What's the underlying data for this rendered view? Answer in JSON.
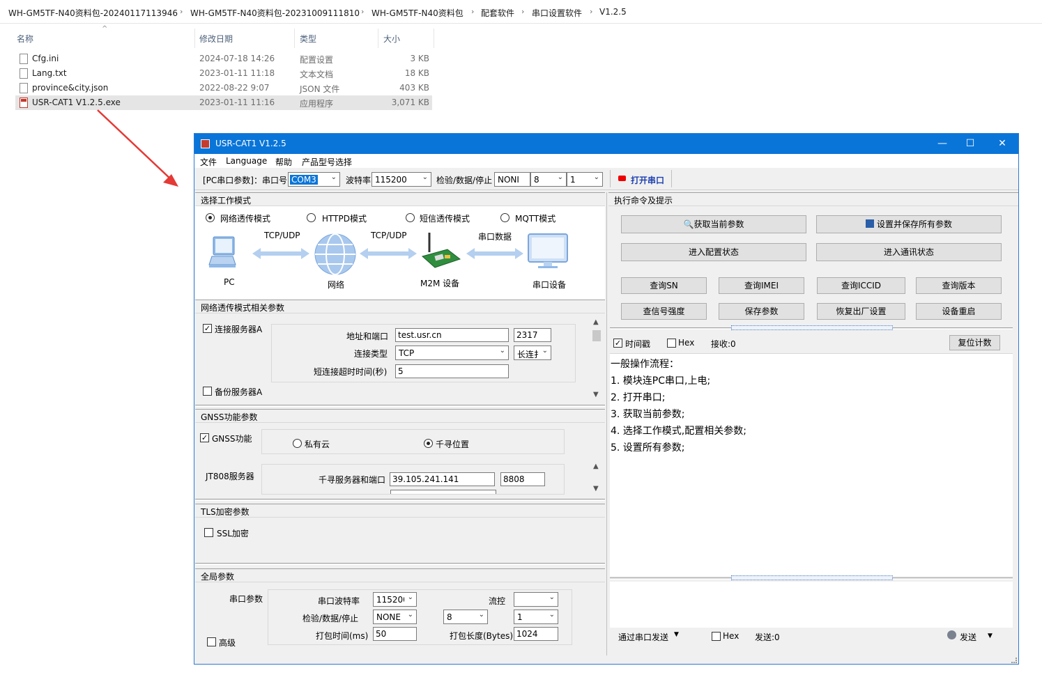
{
  "breadcrumb": [
    "WH-GM5TF-N40资料包-20240117113946",
    "WH-GM5TF-N40资料包-20231009111810",
    "WH-GM5TF-N40资料包",
    "配套软件",
    "串口设置软件",
    "V1.2.5"
  ],
  "breadcrumb_sep": "›",
  "explorer": {
    "columns": {
      "name": "名称",
      "date": "修改日期",
      "type": "类型",
      "size": "大小"
    },
    "sort_arrow": "^",
    "files": [
      {
        "name": "Cfg.ini",
        "date": "2024-07-18 14:26",
        "type": "配置设置",
        "size": "3 KB"
      },
      {
        "name": "Lang.txt",
        "date": "2023-01-11 11:18",
        "type": "文本文档",
        "size": "18 KB"
      },
      {
        "name": "province&city.json",
        "date": "2022-08-22 9:07",
        "type": "JSON 文件",
        "size": "403 KB"
      },
      {
        "name": "USR-CAT1 V1.2.5.exe",
        "date": "2023-01-11 11:16",
        "type": "应用程序",
        "size": "3,071 KB"
      }
    ]
  },
  "window": {
    "title": "USR-CAT1 V1.2.5",
    "minimize": "—",
    "maximize": "☐",
    "close": "✕",
    "menu": [
      "文件",
      "Language",
      "帮助",
      "产品型号选择"
    ],
    "toolbar": {
      "pc_serial_label": "[PC串口参数]：串口号",
      "port": "COM3",
      "baud_label": "波特率",
      "baud": "115200",
      "check_label": "检验/数据/停止",
      "parity": "NONI",
      "databits": "8",
      "stopbits": "1",
      "open_port": "打开串口"
    },
    "mode": {
      "header": "选择工作模式",
      "options": [
        "网络透传模式",
        "HTTPD模式",
        "短信透传模式",
        "MQTT模式"
      ],
      "selected": 0,
      "diagram": {
        "pc": "PC",
        "network": "网络",
        "m2m": "M2M 设备",
        "serial_device": "串口设备",
        "link1": "TCP/UDP",
        "link2": "TCP/UDP",
        "link3": "串口数据"
      }
    },
    "net_params": {
      "header": "网络透传模式相关参数",
      "server_a": "连接服务器A",
      "server_a_checked": true,
      "addr_label": "地址和端口",
      "addr": "test.usr.cn",
      "port": "2317",
      "conn_type_label": "连接类型",
      "conn_type": "TCP",
      "conn_mode": "长连扌",
      "timeout_label": "短连接超时时间(秒)",
      "timeout": "5",
      "backup_server": "备份服务器A",
      "backup_checked": false
    },
    "gnss": {
      "header": "GNSS功能参数",
      "enable": "GNSS功能",
      "enabled": true,
      "private_cloud": "私有云",
      "qianxun": "千寻位置",
      "selected": "qianxun",
      "jt808": "JT808服务器",
      "server_label": "千寻服务器和端口",
      "server": "39.105.241.141",
      "port": "8808"
    },
    "tls": {
      "header": "TLS加密参数",
      "ssl": "SSL加密",
      "ssl_checked": false
    },
    "global": {
      "header": "全局参数",
      "serial_params": "串口参数",
      "baud_label": "串口波特率",
      "baud": "115200",
      "flow_label": "流控",
      "flow": "",
      "check_label": "检验/数据/停止",
      "parity": "NONE",
      "databits": "8",
      "stopbits": "1",
      "pack_time_label": "打包时间(ms)",
      "pack_time": "50",
      "pack_len_label": "打包长度(Bytes)",
      "pack_len": "1024",
      "advanced": "高级",
      "advanced_checked": false
    },
    "right": {
      "header": "执行命令及提示",
      "get_params": "获取当前参数",
      "save_all": "设置并保存所有参数",
      "enter_config": "进入配置状态",
      "enter_comm": "进入通讯状态",
      "query_sn": "查询SN",
      "query_imei": "查询IMEI",
      "query_iccid": "查询ICCID",
      "query_version": "查询版本",
      "query_signal": "查信号强度",
      "save_params": "保存参数",
      "factory_reset": "恢复出厂设置",
      "reboot": "设备重启",
      "timestamp": "时间戳",
      "timestamp_checked": true,
      "hex": "Hex",
      "hex_checked": false,
      "receive": "接收:0",
      "reset_count": "复位计数",
      "log": [
        "一般操作流程：",
        "1. 模块连PC串口,上电;",
        "2. 打开串口;",
        "3. 获取当前参数;",
        "4. 选择工作模式,配置相关参数;",
        "5. 设置所有参数;"
      ],
      "send_via": "通过串口发送",
      "send_hex": "Hex",
      "send_count": "发送:0",
      "send_button": "发送"
    }
  }
}
